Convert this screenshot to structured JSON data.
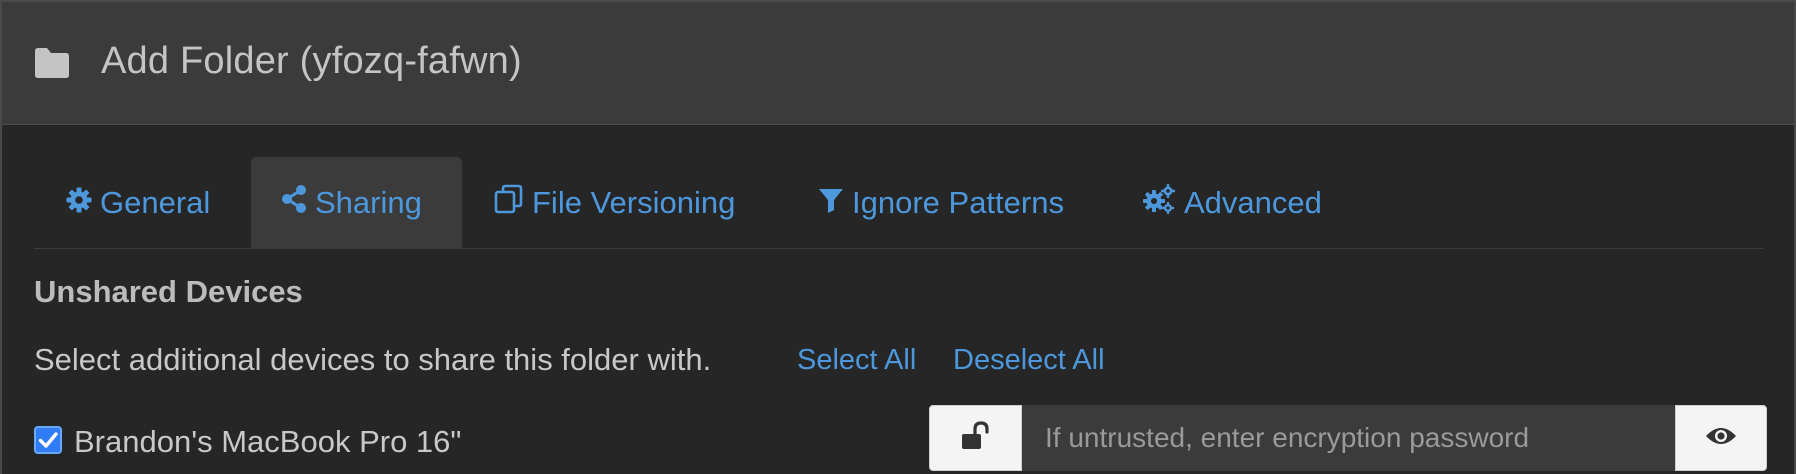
{
  "dialog": {
    "title": "Add Folder (yfozq-fafwn)",
    "icon": "folder-icon"
  },
  "tabs": [
    {
      "label": "General",
      "icon": "gear-icon",
      "active": false
    },
    {
      "label": "Sharing",
      "icon": "share-icon",
      "active": true
    },
    {
      "label": "File Versioning",
      "icon": "copy-icon",
      "active": false
    },
    {
      "label": "Ignore Patterns",
      "icon": "filter-icon",
      "active": false
    },
    {
      "label": "Advanced",
      "icon": "gears-icon",
      "active": false
    }
  ],
  "sharing": {
    "heading": "Unshared Devices",
    "help_text": "Select additional devices to share this folder with.",
    "select_all": "Select All",
    "deselect_all": "Deselect All",
    "devices": [
      {
        "name": "Brandon's MacBook Pro 16\"",
        "checked": true,
        "password_placeholder": "If untrusted, enter encryption password",
        "password_value": ""
      }
    ]
  },
  "colors": {
    "accent": "#4d98dc",
    "header_bg": "#3b3b3b",
    "body_bg": "#262626",
    "checkbox": "#2f7cf6"
  }
}
